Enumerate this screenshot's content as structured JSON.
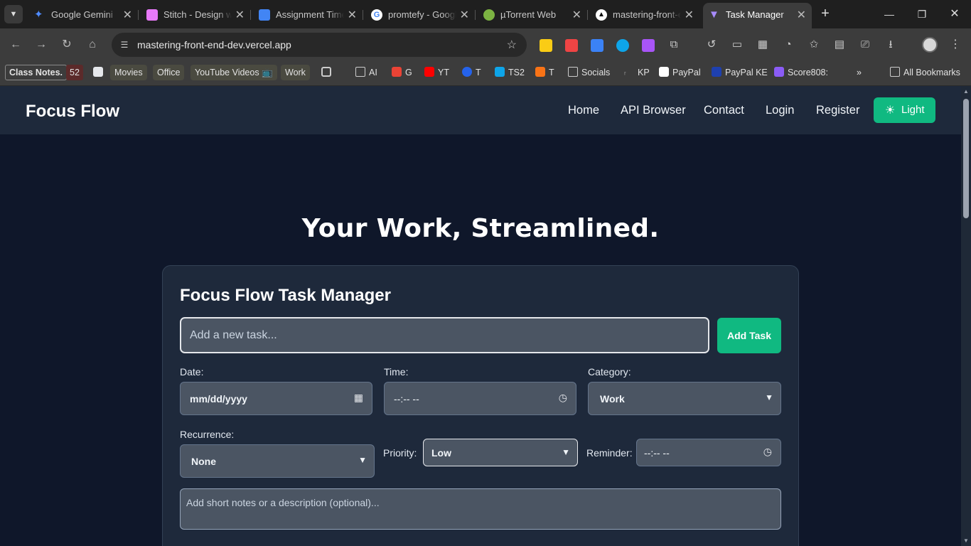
{
  "browser": {
    "tabs": [
      {
        "title": "Google Gemini",
        "favicon_color": "#4f8cff"
      },
      {
        "title": "Stitch - Design with AI",
        "favicon_color": "#e879f9"
      },
      {
        "title": "Assignment Timeline",
        "favicon_color": "#4285f4"
      },
      {
        "title": "promtefy - Google Search",
        "favicon_color": "#ffffff"
      },
      {
        "title": "µTorrent Web",
        "favicon_color": "#7cb342"
      },
      {
        "title": "mastering-front-end-dev",
        "favicon_color": "#000000"
      },
      {
        "title": "Task Manager",
        "favicon_color": "#a78bfa"
      }
    ],
    "url": "mastering-front-end-dev.vercel.app",
    "bookmarks": [
      {
        "label": "Class Notes."
      },
      {
        "label": "52"
      },
      {
        "label": "Movies"
      },
      {
        "label": "Office"
      },
      {
        "label": "YouTube Videos 📺"
      },
      {
        "label": "Work"
      },
      {
        "label": "AI"
      },
      {
        "label": "G"
      },
      {
        "label": "YT"
      },
      {
        "label": "T"
      },
      {
        "label": "TS2"
      },
      {
        "label": "T"
      },
      {
        "label": "Socials"
      },
      {
        "label": "KP"
      },
      {
        "label": "PayPal"
      },
      {
        "label": "PayPal KE"
      },
      {
        "label": "Score808:"
      },
      {
        "label": "All Bookmarks"
      }
    ]
  },
  "navbar": {
    "brand": "Focus Flow",
    "links": [
      "Home",
      "API Browser",
      "Contact",
      "Login",
      "Register"
    ],
    "theme_button": "Light"
  },
  "hero": {
    "title": "Your Work, Streamlined."
  },
  "task_form": {
    "title": "Focus Flow Task Manager",
    "task_placeholder": "Add a new task...",
    "add_button": "Add Task",
    "date_label": "Date:",
    "date_value": "mm/dd/yyyy",
    "time_label": "Time:",
    "time_value": "--:-- --",
    "category_label": "Category:",
    "category_value": "Work",
    "recurrence_label": "Recurrence:",
    "recurrence_value": "None",
    "priority_label": "Priority:",
    "priority_value": "Low",
    "reminder_label": "Reminder:",
    "reminder_value": "--:-- --",
    "notes_placeholder": "Add short notes or a description (optional)..."
  },
  "colors": {
    "accent": "#10b981",
    "background": "#0f172a",
    "card": "#1e293b"
  }
}
